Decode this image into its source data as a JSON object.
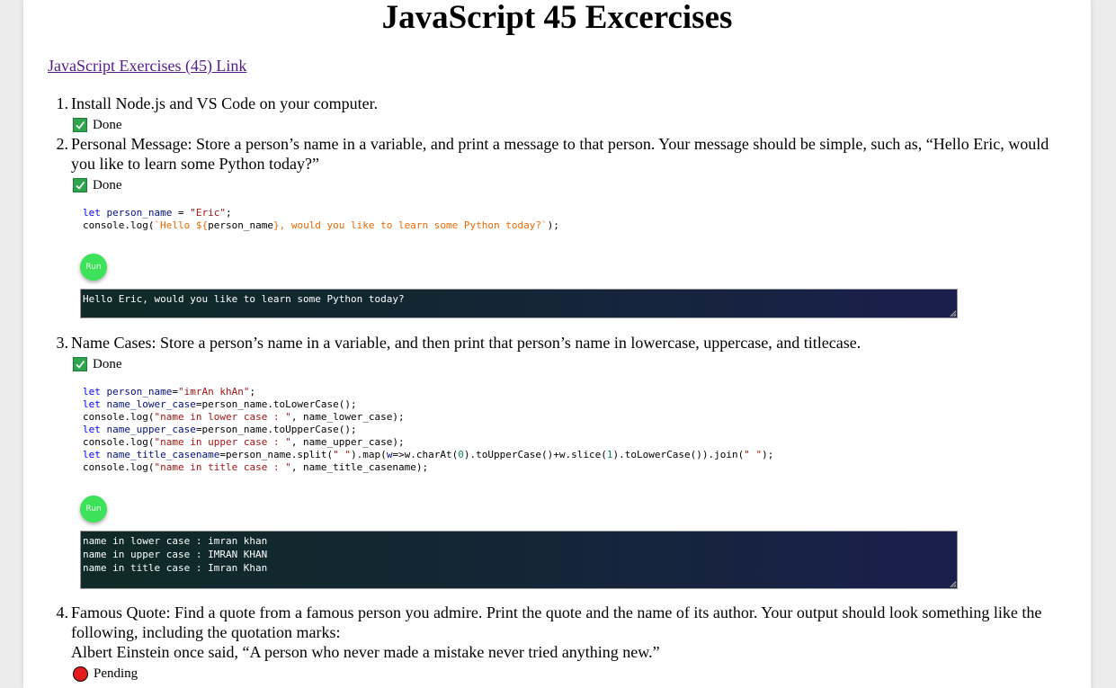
{
  "page": {
    "title": "JavaScript 45 Excercises",
    "link_label": "JavaScript Exercises (45) Link"
  },
  "exercises": [
    {
      "number": "1.",
      "text": "Install Node.js and VS Code on your computer.",
      "status": "Done"
    },
    {
      "number": "2.",
      "text": "Personal Message: Store a person’s name in a variable, and print a message to that person. Your message should be simple, such as, “Hello Eric, would you like to learn some Python today?”",
      "status": "Done",
      "code_lines": [
        "let person_name = \"Eric\";",
        "console.log(`Hello ${person_name}, would you like to learn some Python today?`);"
      ],
      "run_label": "Run",
      "output": "Hello Eric, would you like to learn some Python today?"
    },
    {
      "number": "3.",
      "text": "Name Cases: Store a person’s name in a variable, and then print that person’s name in lowercase, uppercase, and titlecase.",
      "status": "Done",
      "code_lines": [
        "let person_name=\"imrAn khAn\";",
        "let name_lower_case=person_name.toLowerCase();",
        "console.log(\"name in lower case : \", name_lower_case);",
        "let name_upper_case=person_name.toUpperCase();",
        "console.log(\"name in upper case : \", name_upper_case);",
        "let name_title_casename=person_name.split(\" \").map(w=>w.charAt(0).toUpperCase()+w.slice(1).toLowerCase()).join(\" \");",
        "console.log(\"name in title case : \", name_title_casename);"
      ],
      "run_label": "Run",
      "output": "name in lower case : imran khan\nname in upper case : IMRAN KHAN\nname in title case : Imran Khan"
    },
    {
      "number": "4.",
      "text": "Famous Quote: Find a quote from a famous person you admire. Print the quote and the name of its author. Your output should look something like the following, including the quotation marks:",
      "quote": "Albert Einstein once said, “A person who never made a mistake never tried anything new.”",
      "status": "Pending"
    }
  ],
  "colors": {
    "done": "#2ea44f",
    "pending": "#e31b1b",
    "run_button": "#3ce25a",
    "link": "#551a8b"
  }
}
